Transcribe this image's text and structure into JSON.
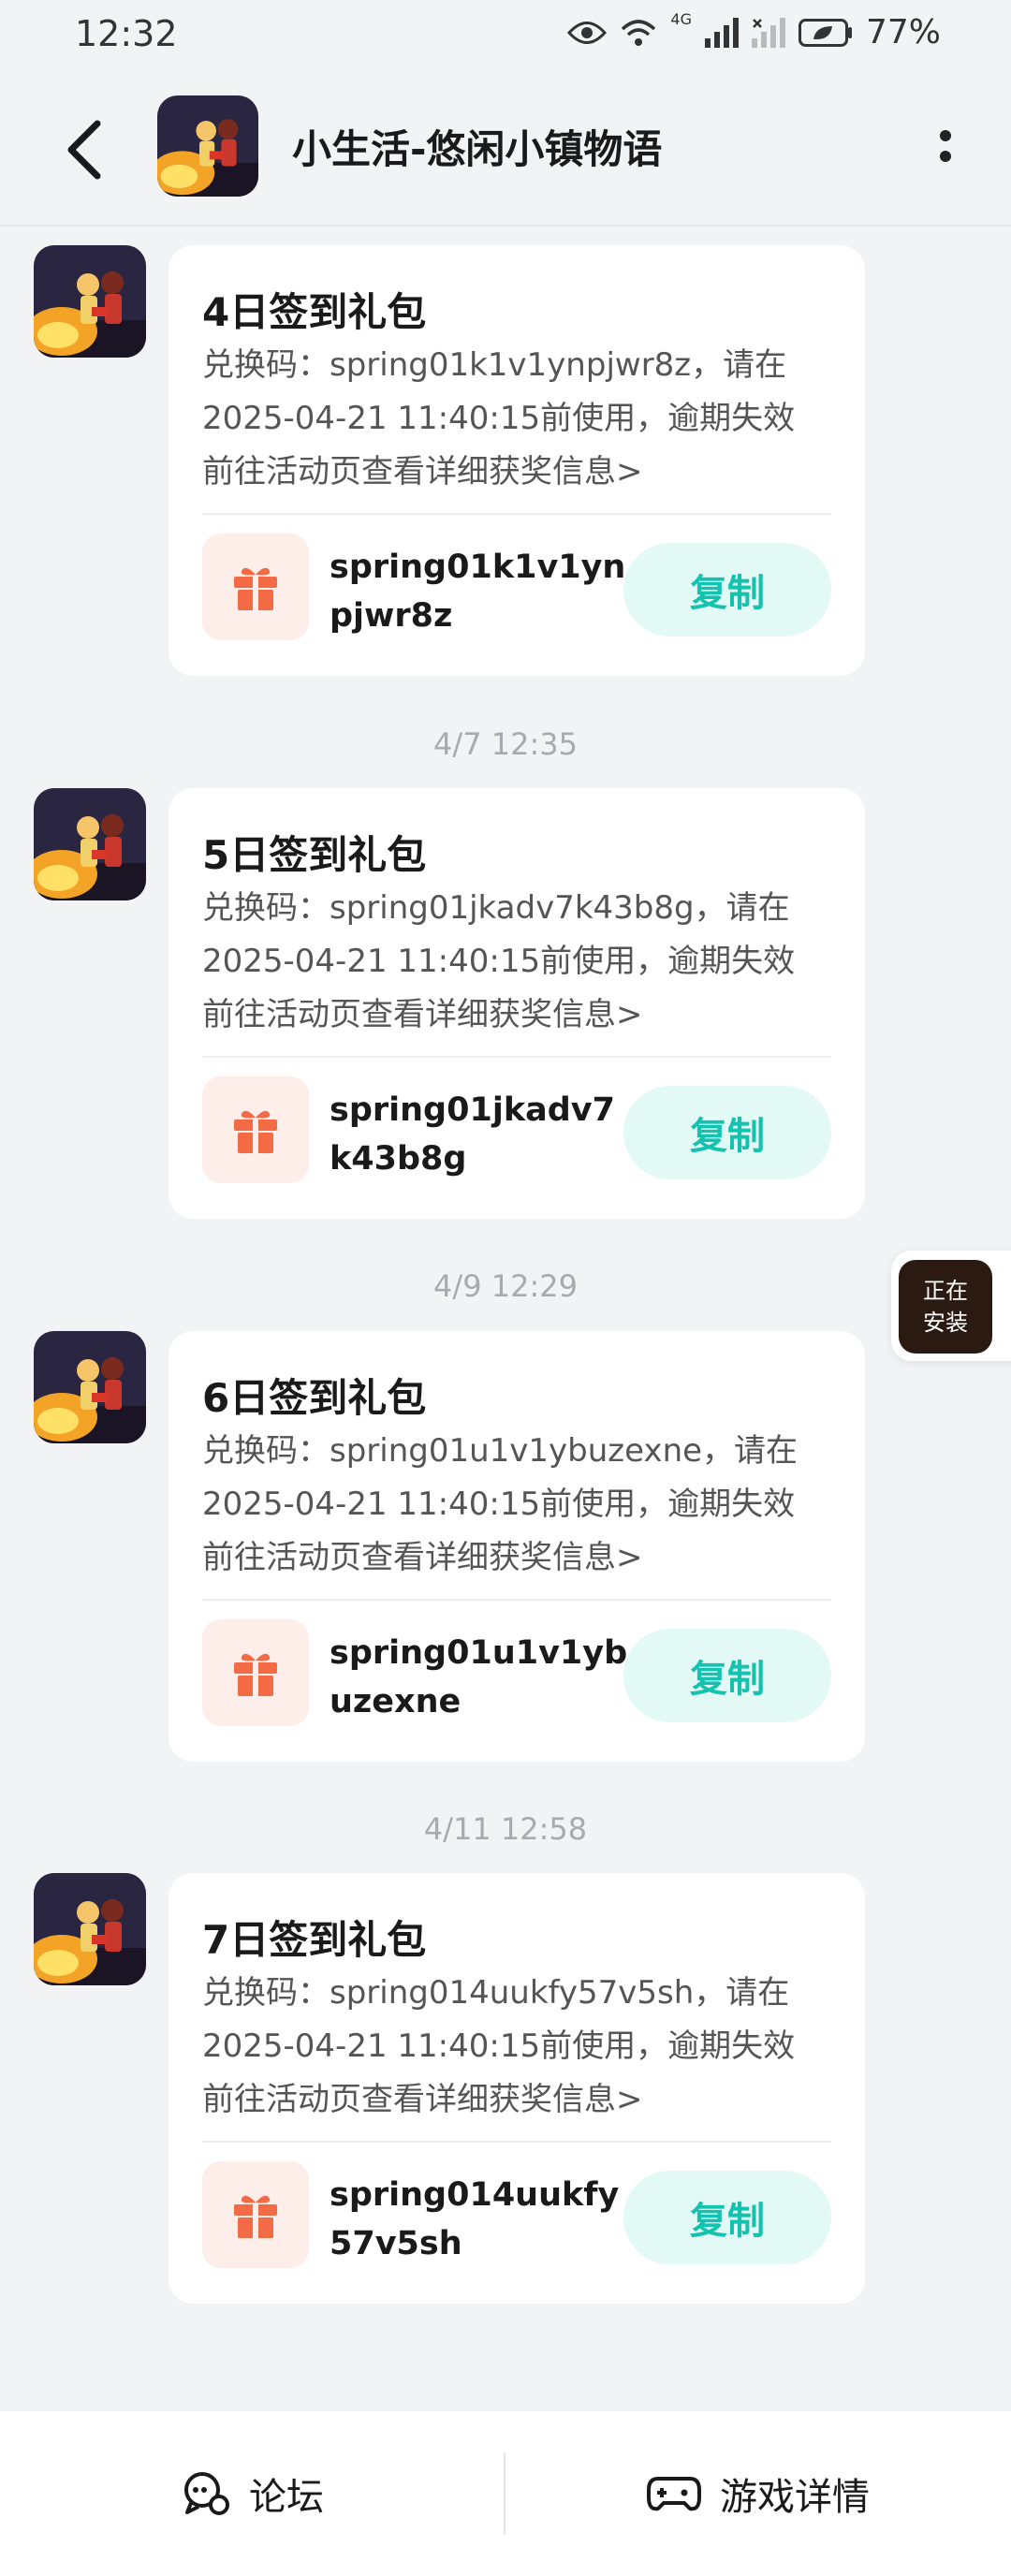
{
  "status_bar": {
    "time": "12:32",
    "network": "4G",
    "battery": "77%"
  },
  "header": {
    "title": "小生活-悠闲小镇物语"
  },
  "messages": [
    {
      "title": "4日签到礼包",
      "line1": "兑换码：spring01k1v1ynpjwr8z，请在",
      "line2": "2025-04-21 11:40:15前使用，逾期失效",
      "line3": "前往活动页查看详细获奖信息>",
      "code_line1": "spring01k1v1yn",
      "code_line2": "pjwr8z",
      "copy_label": "复制"
    },
    {
      "timestamp": "4/7  12:35",
      "title": "5日签到礼包",
      "line1": "兑换码：spring01jkadv7k43b8g，请在",
      "line2": "2025-04-21 11:40:15前使用，逾期失效",
      "line3": "前往活动页查看详细获奖信息>",
      "code_line1": "spring01jkadv7",
      "code_line2": "k43b8g",
      "copy_label": "复制"
    },
    {
      "timestamp": "4/9  12:29",
      "title": "6日签到礼包",
      "line1": "兑换码：spring01u1v1ybuzexne，请在",
      "line2": "2025-04-21 11:40:15前使用，逾期失效",
      "line3": "前往活动页查看详细获奖信息>",
      "code_line1": "spring01u1v1yb",
      "code_line2": "uzexne",
      "copy_label": "复制"
    },
    {
      "timestamp": "4/11  12:58",
      "title": "7日签到礼包",
      "line1": "兑换码：spring014uukfy57v5sh，请在",
      "line2": "2025-04-21 11:40:15前使用，逾期失效",
      "line3": "前往活动页查看详细获奖信息>",
      "code_line1": "spring014uukfy",
      "code_line2": "57v5sh",
      "copy_label": "复制"
    }
  ],
  "float_widget": {
    "line1": "正在",
    "line2": "安装"
  },
  "bottom_bar": {
    "forum_label": "论坛",
    "game_detail_label": "游戏详情"
  },
  "colors": {
    "accent": "#14c2b0",
    "copy_bg": "#e2f9f6",
    "gift": "#f26b45",
    "gift_bg": "#fdeee9",
    "page_bg": "#f2f3f5"
  }
}
